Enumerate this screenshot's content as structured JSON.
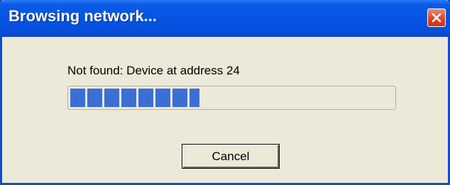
{
  "window": {
    "title": "Browsing network...",
    "close_icon": "close-icon"
  },
  "status": {
    "message": "Not found: Device at address 24",
    "progress_fraction": 0.4
  },
  "buttons": {
    "cancel_label": "Cancel"
  },
  "colors": {
    "titlebar": "#0554e3",
    "progress_fill": "#3c6fd5",
    "dialog_background": "#ece9d8",
    "close_button": "#d9492a"
  }
}
